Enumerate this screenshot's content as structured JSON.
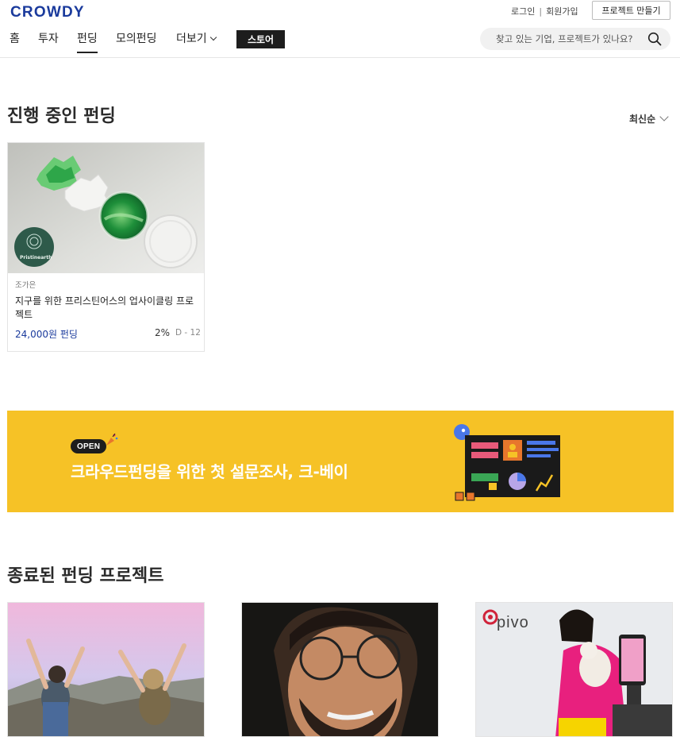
{
  "header": {
    "logo": "CROWDY",
    "login": "로그인",
    "signup": "회원가입",
    "make_project": "프로젝트 만들기",
    "nav": [
      "홈",
      "투자",
      "펀딩",
      "모의펀딩",
      "더보기"
    ],
    "active_nav": "펀딩",
    "store": "스토어",
    "search_placeholder": "찾고 있는 기업, 프로젝트가 있나요?"
  },
  "ongoing": {
    "title": "진행 중인 펀딩",
    "sort_label": "최신순",
    "cards": [
      {
        "logo_text": "Pristinearth",
        "maker": "조가은",
        "title": "지구를 위한 프리스틴어스의 업사이클링 프로젝트",
        "amount": "24,000원 펀딩",
        "percent": "2%",
        "dday": "D - 12"
      }
    ]
  },
  "banner": {
    "badge": "OPEN",
    "text": "크라우드펀딩을 위한 첫 설문조사, 크-베이",
    "background": "#f6c226"
  },
  "ended": {
    "title": "종료된 펀딩 프로젝트",
    "cards": [
      {
        "brand": ""
      },
      {
        "brand": ""
      },
      {
        "brand": "pivo"
      }
    ]
  },
  "colors": {
    "brand": "#1a3a9c",
    "store_button": "#1d1d1d"
  }
}
